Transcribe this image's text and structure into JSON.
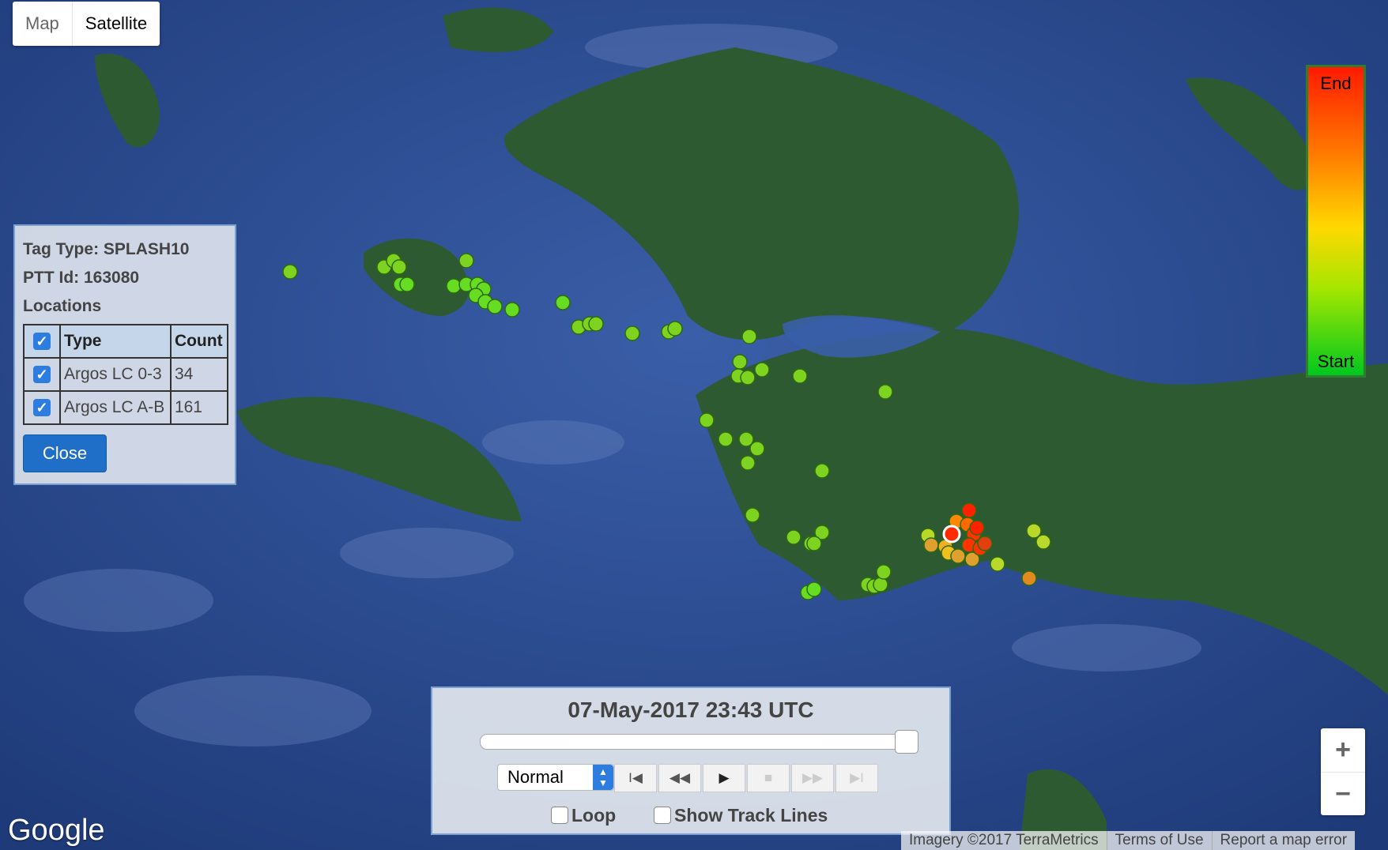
{
  "map_type": {
    "map_label": "Map",
    "satellite_label": "Satellite",
    "selected": "Satellite"
  },
  "legend": {
    "end_label": "End",
    "start_label": "Start",
    "colors": [
      "#ff1a00",
      "#ffd800",
      "#00c81e"
    ]
  },
  "info_panel": {
    "tag_type": "Tag Type: SPLASH10",
    "ptt_id": "PTT Id: 163080",
    "locations_heading": "Locations",
    "columns": [
      "Type",
      "Count"
    ],
    "rows": [
      {
        "type": "Argos LC 0-3",
        "count": "34",
        "checked": true
      },
      {
        "type": "Argos LC A-B",
        "count": "161",
        "checked": true
      }
    ],
    "close_label": "Close"
  },
  "player": {
    "timestamp": "07-May-2017 23:43 UTC",
    "progress": 1.0,
    "speed": "Normal",
    "loop_label": "Loop",
    "loop_checked": false,
    "track_lines_label": "Show Track Lines",
    "track_lines_checked": false,
    "buttons": [
      {
        "name": "first",
        "icon": "skip-start-icon",
        "glyph": "I◀",
        "enabled": true
      },
      {
        "name": "rewind",
        "icon": "rewind-icon",
        "glyph": "◀◀",
        "enabled": true
      },
      {
        "name": "play",
        "icon": "play-icon",
        "glyph": "▶",
        "enabled": true
      },
      {
        "name": "stop",
        "icon": "stop-icon",
        "glyph": "■",
        "enabled": false
      },
      {
        "name": "forward",
        "icon": "fast-forward-icon",
        "glyph": "▶▶",
        "enabled": false
      },
      {
        "name": "last",
        "icon": "skip-end-icon",
        "glyph": "▶I",
        "enabled": false
      }
    ]
  },
  "zoom": {
    "in_label": "+",
    "out_label": "−"
  },
  "footer": {
    "logo": "Google",
    "imagery": "Imagery ©2017 TerraMetrics",
    "terms": "Terms of Use",
    "report": "Report a map error"
  }
}
